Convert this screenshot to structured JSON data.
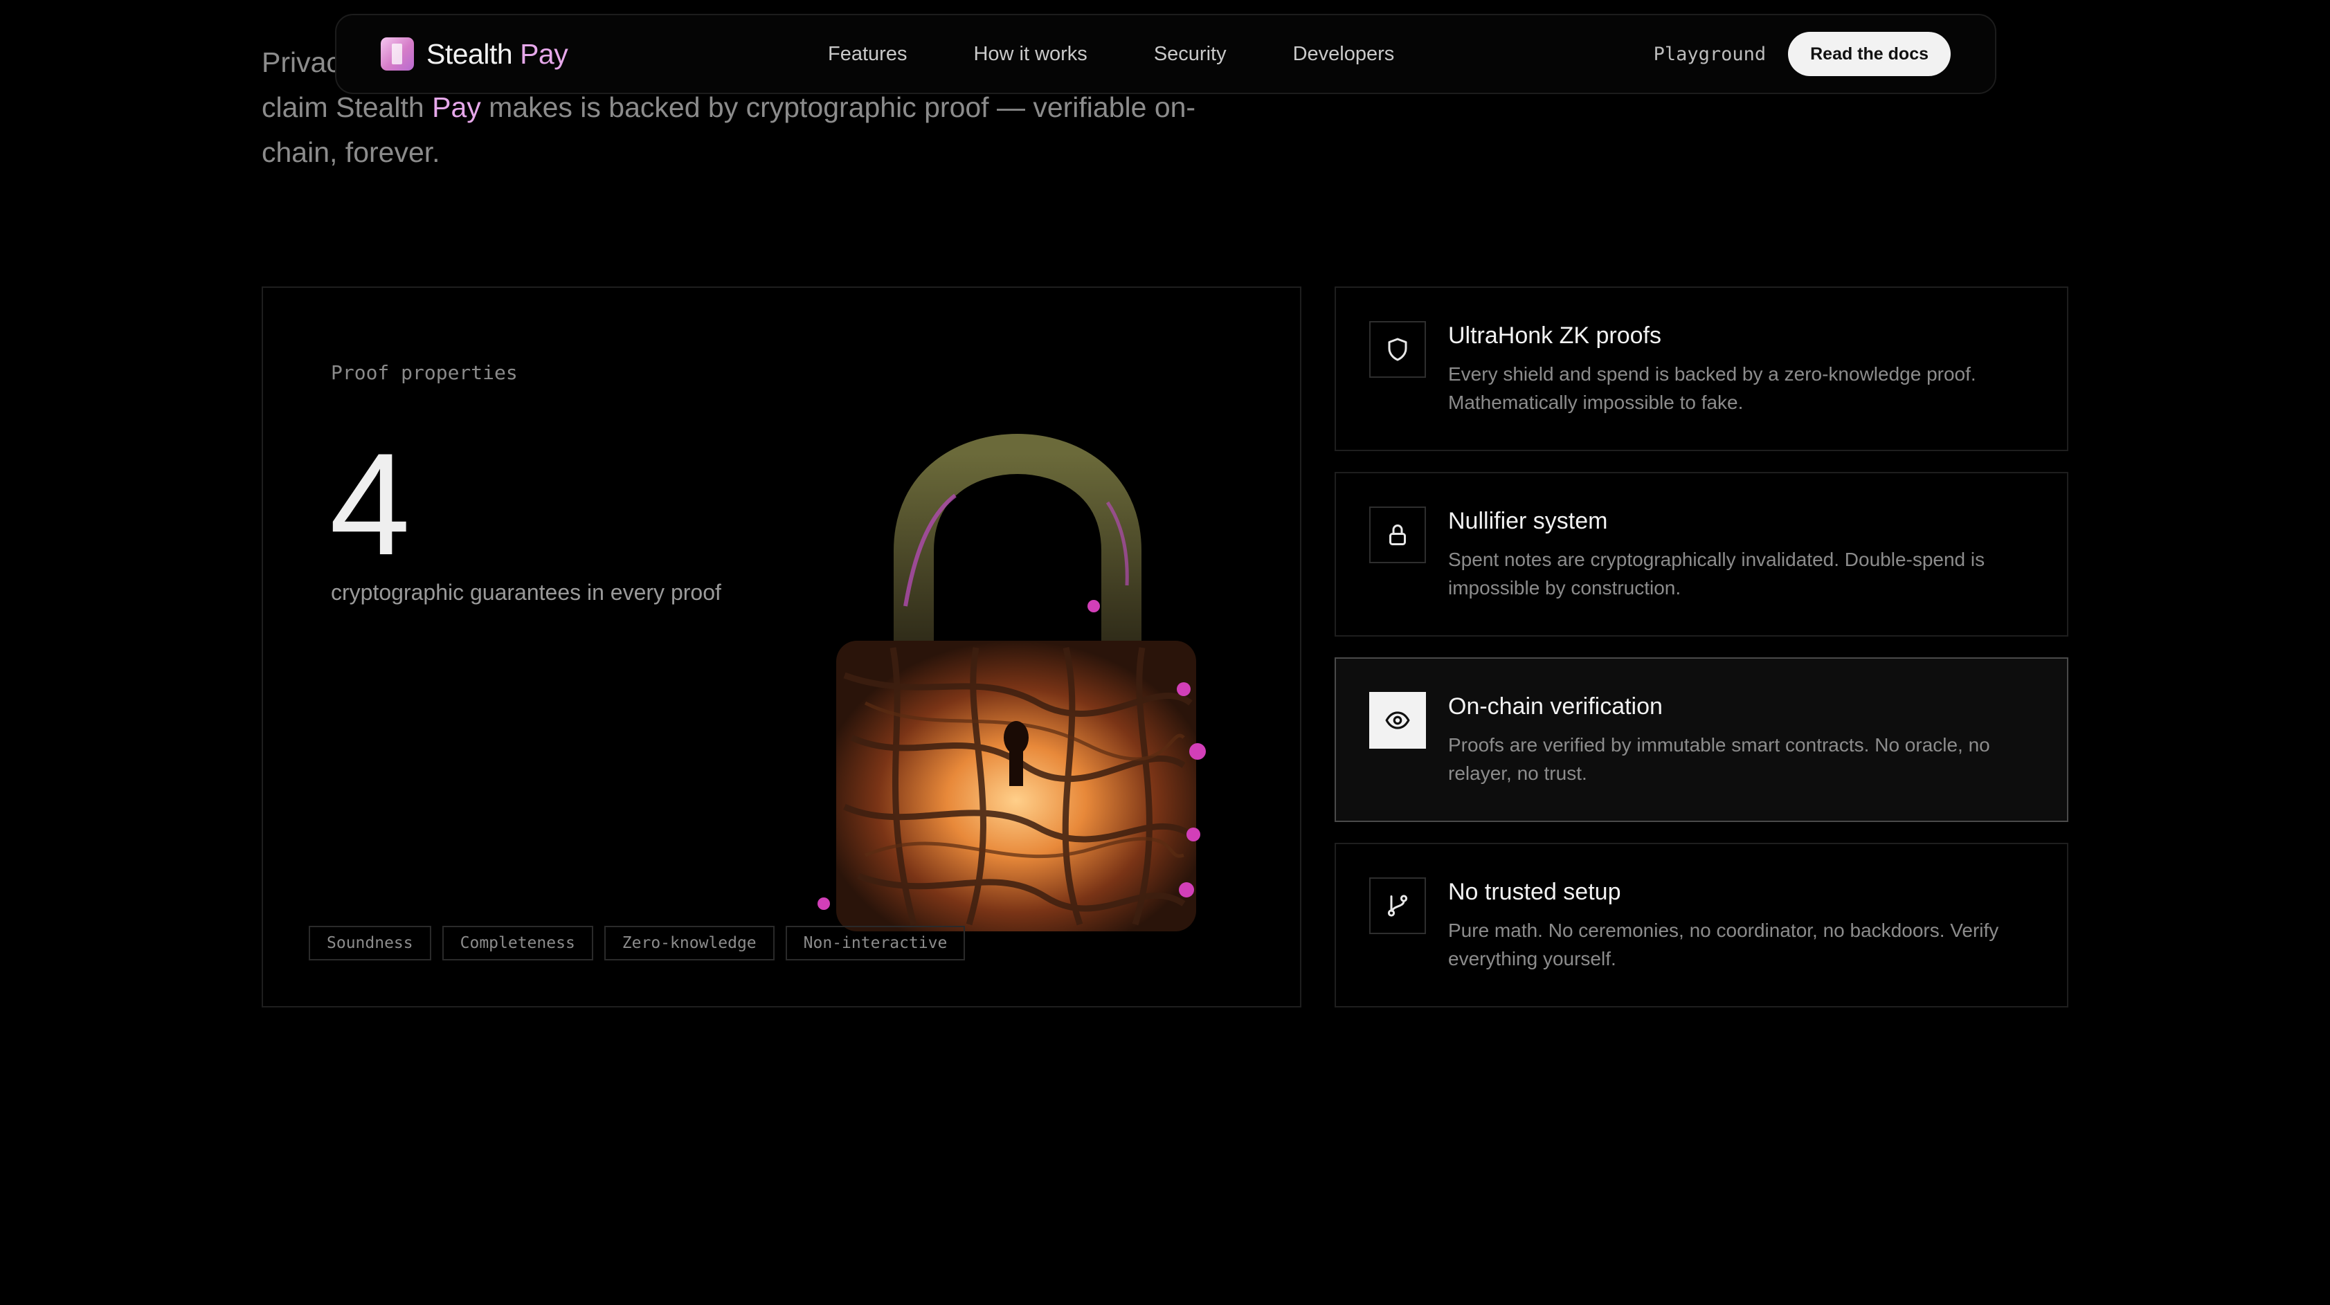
{
  "intro": {
    "prefix": "Privac",
    "line2_start": "claim Stealth ",
    "line2_highlight": "Pay",
    "line2_end": " makes is backed by cryptographic proof — verifiable on-",
    "line3": "chain, forever."
  },
  "nav": {
    "brand_main": "Stealth",
    "brand_accent": "Pay",
    "links": [
      "Features",
      "How it works",
      "Security",
      "Developers"
    ],
    "playground": "Playground",
    "docs_button": "Read the docs"
  },
  "proof": {
    "kicker": "Proof properties",
    "number": "4",
    "subtitle": "cryptographic guarantees in every proof",
    "tags": [
      "Soundness",
      "Completeness",
      "Zero-knowledge",
      "Non-interactive"
    ]
  },
  "features": [
    {
      "icon": "shield-icon",
      "title": "UltraHonk ZK proofs",
      "description": "Every shield and spend is backed by a zero-knowledge proof. Mathematically impossible to fake.",
      "active": false
    },
    {
      "icon": "lock-icon",
      "title": "Nullifier system",
      "description": "Spent notes are cryptographically invalidated. Double-spend is impossible by construction.",
      "active": false
    },
    {
      "icon": "eye-icon",
      "title": "On-chain verification",
      "description": "Proofs are verified by immutable smart contracts. No oracle, no relayer, no trust.",
      "active": true
    },
    {
      "icon": "git-branch-icon",
      "title": "No trusted setup",
      "description": "Pure math. No ceremonies, no coordinator, no backdoors. Verify everything yourself.",
      "active": false
    }
  ],
  "colors": {
    "background": "#000000",
    "accent": "#e6a8ea",
    "muted_text": "#8c8c8c"
  }
}
